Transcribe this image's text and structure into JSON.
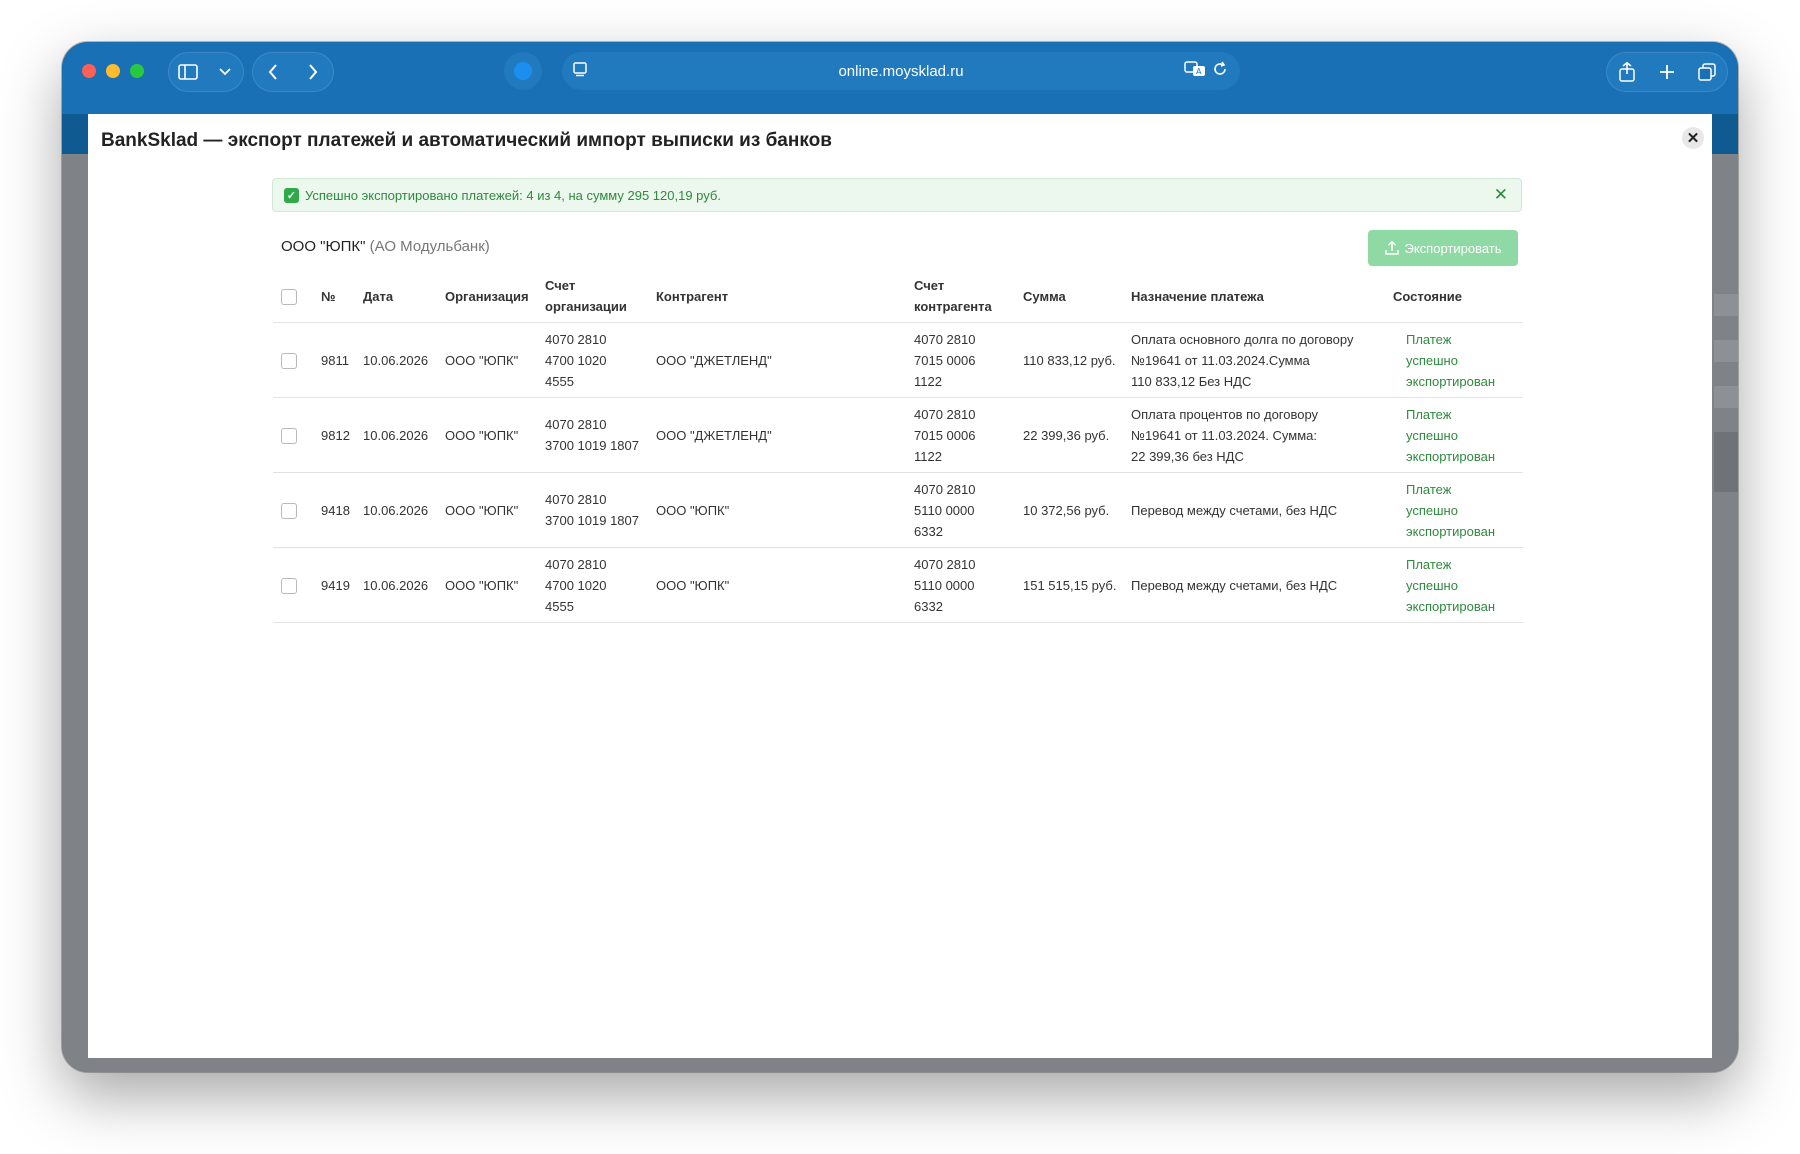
{
  "browser": {
    "url": "online.moysklad.ru"
  },
  "modal": {
    "title": "BankSklad — экспорт платежей и автоматический импорт выписки из банков",
    "close_symbol": "✕",
    "alert": {
      "text": "Успешно экспортировано платежей: 4 из 4, на сумму 295 120,19 руб."
    },
    "company": "ООО \"ЮПК\"",
    "bank": "(АО Модульбанк)",
    "export_button": "Экспортировать",
    "table": {
      "headers": {
        "num": "№",
        "date": "Дата",
        "org": "Организация",
        "org_account_1": "Счет",
        "org_account_2": "организации",
        "counterparty": "Контрагент",
        "cp_account_1": "Счет",
        "cp_account_2": "контрагента",
        "sum": "Сумма",
        "purpose": "Назначение платежа",
        "status": "Состояние"
      },
      "rows": [
        {
          "num": "9811",
          "date": "10.06.2026",
          "org": "ООО \"ЮПК\"",
          "org_acc": [
            "4070 2810",
            "4700 1020",
            "4555"
          ],
          "counterparty": "ООО \"ДЖЕТЛЕНД\"",
          "cp_acc": [
            "4070 2810",
            "7015 0006",
            "1122"
          ],
          "sum": "110 833,12 руб.",
          "purpose": [
            "Оплата основного долга по договору",
            "№19641 от 11.03.2024.Сумма",
            "110 833,12 Без НДС"
          ],
          "status": [
            "Платеж",
            "успешно",
            "экспортирован"
          ]
        },
        {
          "num": "9812",
          "date": "10.06.2026",
          "org": "ООО \"ЮПК\"",
          "org_acc": [
            "4070 2810",
            "3700 1019 1807"
          ],
          "counterparty": "ООО \"ДЖЕТЛЕНД\"",
          "cp_acc": [
            "4070 2810",
            "7015 0006",
            "1122"
          ],
          "sum": "22 399,36 руб.",
          "purpose": [
            "Оплата процентов по договору",
            "№19641 от 11.03.2024. Сумма:",
            "22 399,36 без НДС"
          ],
          "status": [
            "Платеж",
            "успешно",
            "экспортирован"
          ]
        },
        {
          "num": "9418",
          "date": "10.06.2026",
          "org": "ООО \"ЮПК\"",
          "org_acc": [
            "4070 2810",
            "3700 1019 1807"
          ],
          "counterparty": "ООО \"ЮПК\"",
          "cp_acc": [
            "4070 2810",
            "5110 0000",
            "6332"
          ],
          "sum": "10 372,56 руб.",
          "purpose": [
            "Перевод между счетами, без НДС"
          ],
          "status": [
            "Платеж",
            "успешно",
            "экспортирован"
          ]
        },
        {
          "num": "9419",
          "date": "10.06.2026",
          "org": "ООО \"ЮПК\"",
          "org_acc": [
            "4070 2810",
            "4700 1020",
            "4555"
          ],
          "counterparty": "ООО \"ЮПК\"",
          "cp_acc": [
            "4070 2810",
            "5110 0000",
            "6332"
          ],
          "sum": "151 515,15 руб.",
          "purpose": [
            "Перевод между счетами, без НДС"
          ],
          "status": [
            "Платеж",
            "успешно",
            "экспортирован"
          ]
        }
      ]
    }
  },
  "colors": {
    "toolbar": "#1a70b5",
    "success_green": "#2f8a3e",
    "export_button": "#8fd9a4"
  }
}
